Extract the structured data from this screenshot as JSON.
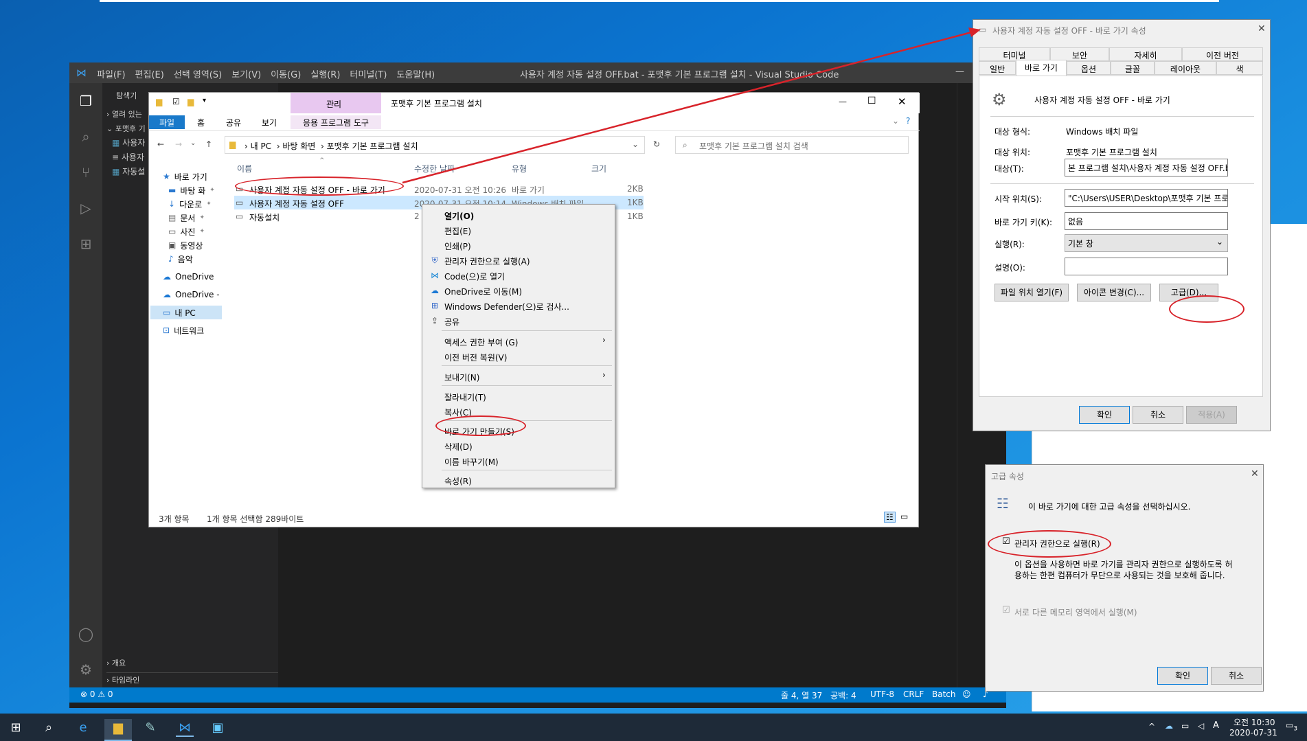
{
  "vscode": {
    "menu": [
      "파일(F)",
      "편집(E)",
      "선택 영역(S)",
      "보기(V)",
      "이동(G)",
      "실행(R)",
      "터미널(T)",
      "도움말(H)"
    ],
    "title": "사용자 계정 자동 설정 OFF.bat - 포맷후 기본 프로그램 설치 - Visual Studio Code",
    "sidebar_title": "탐색기",
    "open_editors": "열려 있는",
    "folder": "포맷후 기",
    "files": [
      "사용자",
      "사용자",
      "자동설"
    ],
    "outline": "개요",
    "timeline": "타임라인",
    "status": {
      "problems": "⊗ 0 ⚠ 0",
      "position": "줄 4, 열 37",
      "spaces": "공백: 4",
      "encoding": "UTF-8",
      "eol": "CRLF",
      "lang": "Batch"
    }
  },
  "explorer": {
    "title": "포맷후 기본 프로그램 설치",
    "manage_tab": "관리",
    "ribbon": [
      "파일",
      "홈",
      "공유",
      "보기"
    ],
    "app_tools": "응용 프로그램 도구",
    "breadcrumb": [
      "내 PC",
      "바탕 화면",
      "포맷후 기본 프로그램 설치"
    ],
    "search_placeholder": "포맷후 기본 프로그램 설치 검색",
    "nav": [
      "바로 가기",
      "바탕 화",
      "다운로",
      "문서",
      "사진",
      "동영상",
      "음악",
      "OneDrive",
      "OneDrive -",
      "내 PC",
      "네트워크"
    ],
    "columns": [
      "이름",
      "수정한 날짜",
      "유형",
      "크기"
    ],
    "rows": [
      {
        "name": "사용자 계정 자동 설정 OFF - 바로 가기",
        "date": "2020-07-31 오전 10:26",
        "type": "바로 가기",
        "size": "2KB"
      },
      {
        "name": "사용자 계정 자동 설정 OFF",
        "date": "2020-07-31 오전 10:14",
        "type": "Windows 배치 파일",
        "size": "1KB"
      },
      {
        "name": "자동설치",
        "date": "2",
        "type": "",
        "size": "1KB"
      }
    ],
    "status_count": "3개 항목",
    "status_selected": "1개 항목 선택함 289바이트"
  },
  "context_menu": {
    "items": [
      "열기(O)",
      "편집(E)",
      "인쇄(P)",
      "관리자 권한으로 실행(A)",
      "Code(으)로 열기",
      "OneDrive로 이동(M)",
      "Windows Defender(으)로 검사...",
      "공유",
      "액세스 권한 부여 (G)",
      "이전 버전 복원(V)",
      "보내기(N)",
      "잘라내기(T)",
      "복사(C)",
      "바로 가기 만들기(S)",
      "삭제(D)",
      "이름 바꾸기(M)",
      "속성(R)"
    ]
  },
  "props": {
    "title": "사용자 계정 자동 설정 OFF - 바로 가기 속성",
    "tabs_top": [
      "터미널",
      "보안",
      "자세히",
      "이전 버전"
    ],
    "tabs_bottom": [
      "일반",
      "바로 가기",
      "옵션",
      "글꼴",
      "레이아웃",
      "색"
    ],
    "name": "사용자 계정 자동 설정 OFF - 바로 가기",
    "target_type_label": "대상 형식:",
    "target_type": "Windows 배치 파일",
    "target_loc_label": "대상 위치:",
    "target_loc": "포맷후 기본 프로그램 설치",
    "target_label": "대상(T):",
    "target": "본 프로그램 설치\\사용자 계정 자동 설정 OFF.bat\"",
    "start_label": "시작 위치(S):",
    "start": "\"C:\\Users\\USER\\Desktop\\포맷후 기본 프로그램",
    "hotkey_label": "바로 가기 키(K):",
    "hotkey": "없음",
    "run_label": "실행(R):",
    "run": "기본 창",
    "comment_label": "설명(O):",
    "btn_open": "파일 위치 열기(F)",
    "btn_icon": "아이콘 변경(C)...",
    "btn_adv": "고급(D)...",
    "ok": "확인",
    "cancel": "취소",
    "apply": "적용(A)"
  },
  "advanced": {
    "title": "고급 속성",
    "desc": "이 바로 가기에 대한 고급 속성을 선택하십시오.",
    "run_admin": "관리자 권한으로 실행(R)",
    "note1": "이 옵션을 사용하면 바로 가기를 관리자 권한으로 실행하도록 허",
    "note2": "용하는 한편 컴퓨터가 무단으로 사용되는 것을 보호해 줍니다.",
    "separate_mem": "서로 다른 메모리 영역에서 실행(M)",
    "ok": "확인",
    "cancel": "취소"
  },
  "taskbar": {
    "time": "오전 10:30",
    "date": "2020-07-31",
    "ime": "A",
    "notif": "3"
  },
  "accent": "#d8232a"
}
